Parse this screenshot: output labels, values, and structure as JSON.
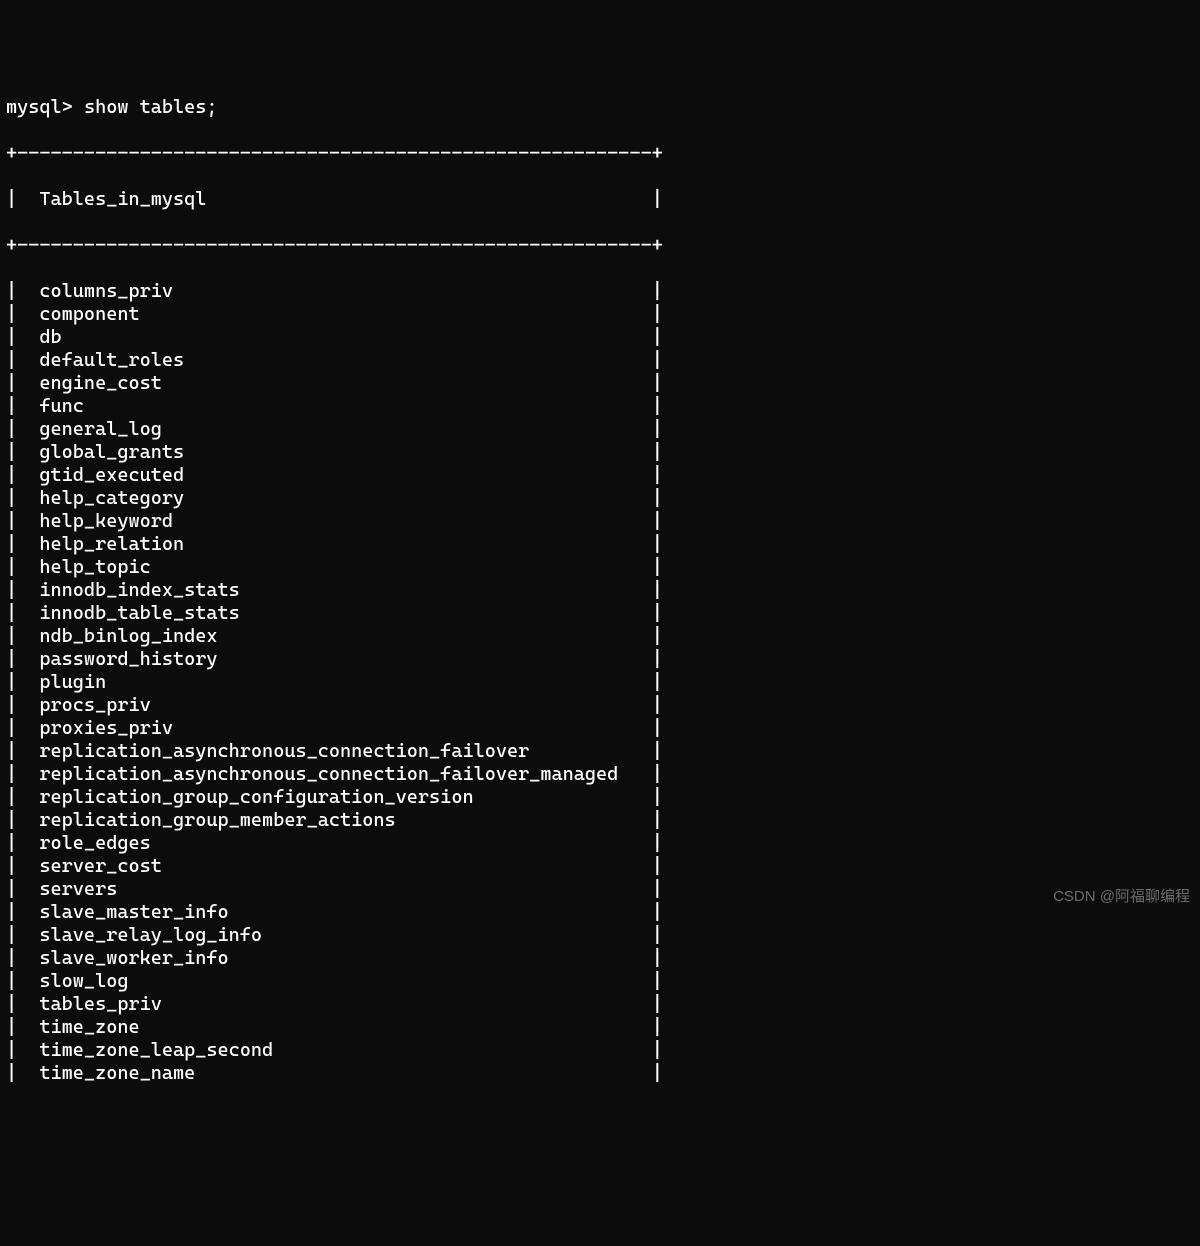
{
  "terminal": {
    "prompt": "mysql> ",
    "command": "show tables;",
    "header": "Tables_in_mysql",
    "dividerTop": "+---------------------------------------------------------+",
    "dividerMid": "+---------------------------------------------------------+",
    "rows": [
      "columns_priv",
      "component",
      "db",
      "default_roles",
      "engine_cost",
      "func",
      "general_log",
      "global_grants",
      "gtid_executed",
      "help_category",
      "help_keyword",
      "help_relation",
      "help_topic",
      "innodb_index_stats",
      "innodb_table_stats",
      "ndb_binlog_index",
      "password_history",
      "plugin",
      "procs_priv",
      "proxies_priv",
      "replication_asynchronous_connection_failover",
      "replication_asynchronous_connection_failover_managed",
      "replication_group_configuration_version",
      "replication_group_member_actions",
      "role_edges",
      "server_cost",
      "servers",
      "slave_master_info",
      "slave_relay_log_info",
      "slave_worker_info",
      "slow_log",
      "tables_priv",
      "time_zone",
      "time_zone_leap_second",
      "time_zone_name"
    ]
  },
  "watermark": "CSDN @阿福聊编程"
}
